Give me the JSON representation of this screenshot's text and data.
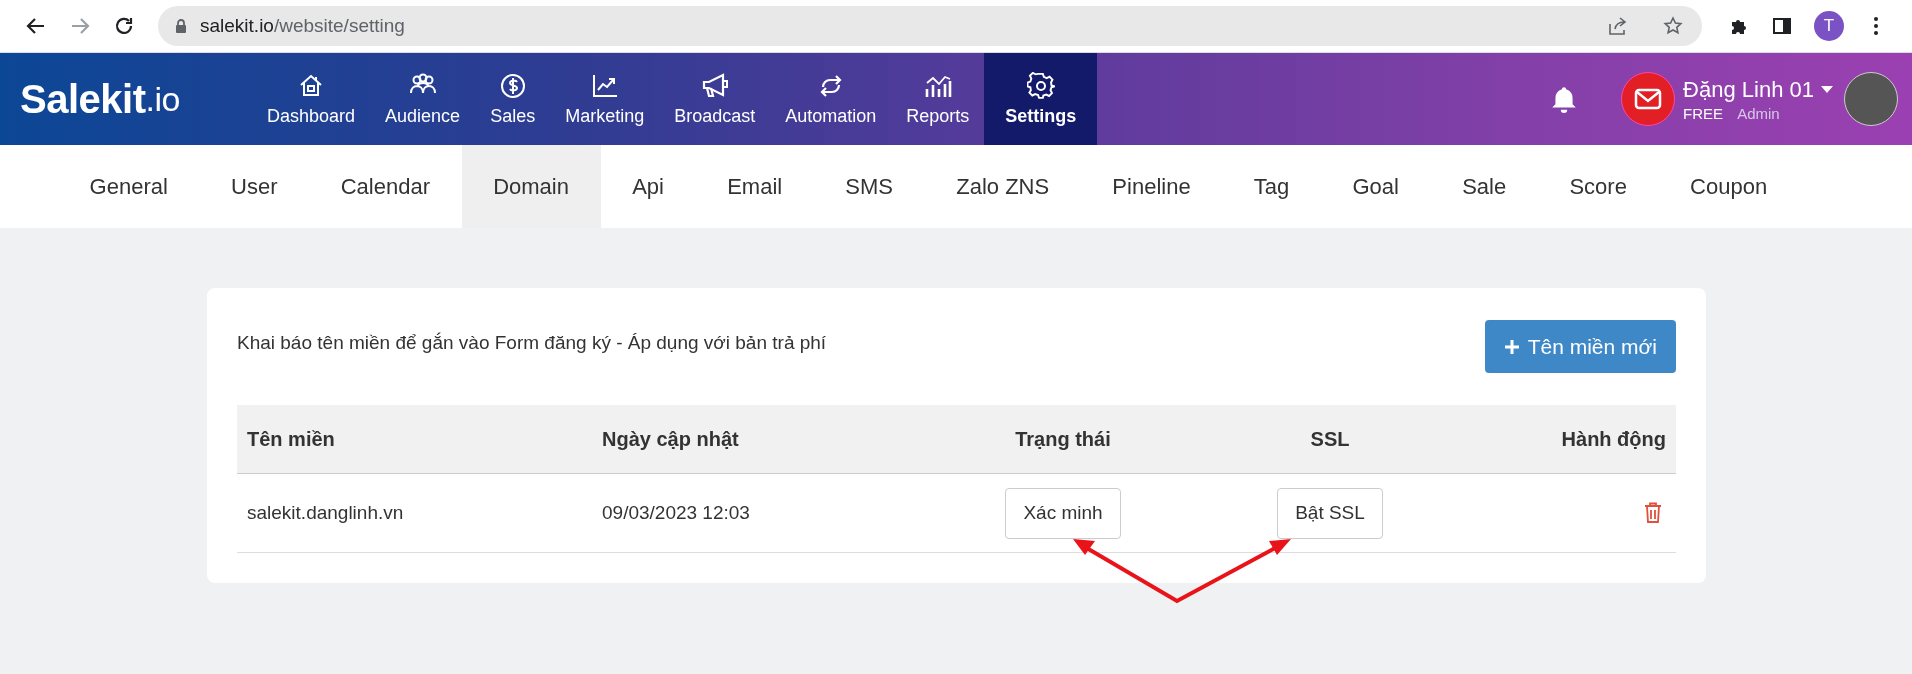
{
  "browser": {
    "url_host": "salekit.io",
    "url_path": "/website/setting",
    "profile_initial": "T"
  },
  "app": {
    "logo": {
      "name": "Salekit",
      "suffix": ".io"
    },
    "nav": [
      {
        "label": "Dashboard",
        "selected": false
      },
      {
        "label": "Audience",
        "selected": false
      },
      {
        "label": "Sales",
        "selected": false
      },
      {
        "label": "Marketing",
        "selected": false
      },
      {
        "label": "Broadcast",
        "selected": false
      },
      {
        "label": "Automation",
        "selected": false
      },
      {
        "label": "Reports",
        "selected": false
      },
      {
        "label": "Settings",
        "selected": true
      }
    ],
    "user": {
      "name": "Đặng Linh 01",
      "plan": "FREE",
      "role": "Admin"
    }
  },
  "tabs": [
    {
      "label": "General",
      "selected": false
    },
    {
      "label": "User",
      "selected": false
    },
    {
      "label": "Calendar",
      "selected": false
    },
    {
      "label": "Domain",
      "selected": true
    },
    {
      "label": "Api",
      "selected": false
    },
    {
      "label": "Email",
      "selected": false
    },
    {
      "label": "SMS",
      "selected": false
    },
    {
      "label": "Zalo ZNS",
      "selected": false
    },
    {
      "label": "Pineline",
      "selected": false
    },
    {
      "label": "Tag",
      "selected": false
    },
    {
      "label": "Goal",
      "selected": false
    },
    {
      "label": "Sale",
      "selected": false
    },
    {
      "label": "Score",
      "selected": false
    },
    {
      "label": "Coupon",
      "selected": false
    }
  ],
  "card": {
    "description": "Khai báo tên miền để gắn vào Form đăng ký - Áp dụng với bản trả phí",
    "add_button": "Tên miền mới",
    "table": {
      "columns": [
        "Tên miền",
        "Ngày cập nhật",
        "Trạng thái",
        "SSL",
        "Hành động"
      ],
      "rows": [
        {
          "domain": "salekit.danglinh.vn",
          "updated": "09/03/2023 12:03",
          "status_button": "Xác minh",
          "ssl_button": "Bật SSL"
        }
      ]
    }
  }
}
